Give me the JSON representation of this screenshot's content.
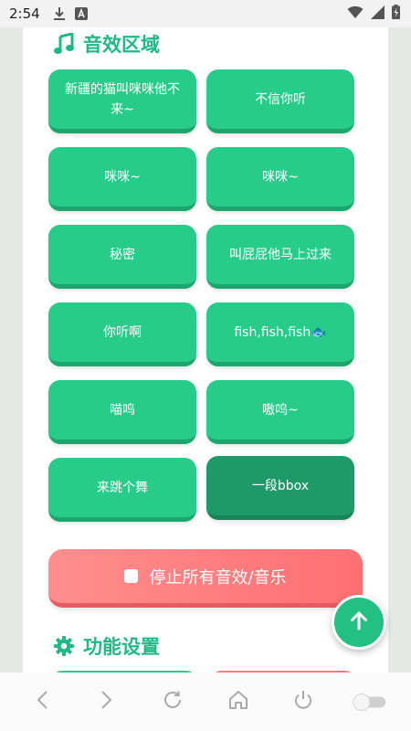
{
  "status_bar": {
    "time": "2:54",
    "icons": [
      "download-icon",
      "notification-a-icon",
      "wifi-icon",
      "signal-icon",
      "battery-charging-icon"
    ]
  },
  "sections": {
    "sound": {
      "title": "音效区域",
      "icon": "music-note-icon"
    },
    "settings": {
      "title": "功能设置",
      "icon": "gear-icon"
    }
  },
  "sound_buttons": [
    {
      "label": "新疆的猫叫咪咪他不来~"
    },
    {
      "label": "不信你听"
    },
    {
      "label": "咪咪~"
    },
    {
      "label": "咪咪~"
    },
    {
      "label": "秘密"
    },
    {
      "label": "叫屁屁他马上过来"
    },
    {
      "label": "你听啊"
    },
    {
      "label": "fish,fish,fish🐟"
    },
    {
      "label": "喵呜"
    },
    {
      "label": "嗷呜~"
    },
    {
      "label": "来跳个舞"
    },
    {
      "label": "一段bbox",
      "state": "pressed"
    }
  ],
  "stop_button": {
    "label": "停止所有音效/音乐",
    "icon": "stop-icon"
  },
  "fab": {
    "icon": "arrow-up-icon"
  },
  "nav_bar": {
    "items": [
      "back-icon",
      "forward-icon",
      "refresh-icon",
      "home-icon",
      "power-icon",
      "toggle-switch"
    ]
  },
  "colors": {
    "accent": "#23c084",
    "button_green": "#28cc8a",
    "button_green_pressed": "#1e9a6a",
    "stop_red": "#ff7a7e",
    "background": "#e4e9e6"
  }
}
